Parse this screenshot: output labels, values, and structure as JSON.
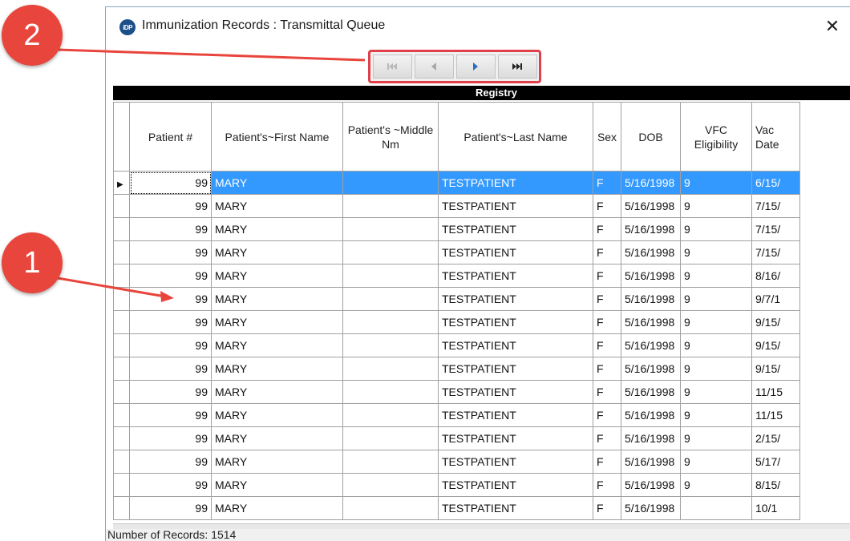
{
  "window": {
    "icon_text": "iDP",
    "title": "Immunization Records : Transmittal Queue",
    "close_symbol": "✕"
  },
  "navigator": {
    "buttons": [
      {
        "name": "first-record",
        "icon": "skip-first-icon",
        "enabled": false
      },
      {
        "name": "previous-record",
        "icon": "previous-icon",
        "enabled": false
      },
      {
        "name": "next-record",
        "icon": "next-icon",
        "enabled": true
      },
      {
        "name": "last-record",
        "icon": "skip-last-icon",
        "enabled": true
      }
    ]
  },
  "registry_label": "Registry",
  "table": {
    "columns": [
      "Patient #",
      "Patient's~First Name",
      "Patient's ~Middle Nm",
      "Patient's~Last Name",
      "Sex",
      "DOB",
      "VFC Eligibility",
      "Vac Date"
    ],
    "rows": [
      [
        "99",
        "MARY",
        "",
        "TESTPATIENT",
        "F",
        "5/16/1998",
        "9",
        "6/15/"
      ],
      [
        "99",
        "MARY",
        "",
        "TESTPATIENT",
        "F",
        "5/16/1998",
        "9",
        "7/15/"
      ],
      [
        "99",
        "MARY",
        "",
        "TESTPATIENT",
        "F",
        "5/16/1998",
        "9",
        "7/15/"
      ],
      [
        "99",
        "MARY",
        "",
        "TESTPATIENT",
        "F",
        "5/16/1998",
        "9",
        "7/15/"
      ],
      [
        "99",
        "MARY",
        "",
        "TESTPATIENT",
        "F",
        "5/16/1998",
        "9",
        "8/16/"
      ],
      [
        "99",
        "MARY",
        "",
        "TESTPATIENT",
        "F",
        "5/16/1998",
        "9",
        "9/7/1"
      ],
      [
        "99",
        "MARY",
        "",
        "TESTPATIENT",
        "F",
        "5/16/1998",
        "9",
        "9/15/"
      ],
      [
        "99",
        "MARY",
        "",
        "TESTPATIENT",
        "F",
        "5/16/1998",
        "9",
        "9/15/"
      ],
      [
        "99",
        "MARY",
        "",
        "TESTPATIENT",
        "F",
        "5/16/1998",
        "9",
        "9/15/"
      ],
      [
        "99",
        "MARY",
        "",
        "TESTPATIENT",
        "F",
        "5/16/1998",
        "9",
        "11/15"
      ],
      [
        "99",
        "MARY",
        "",
        "TESTPATIENT",
        "F",
        "5/16/1998",
        "9",
        "11/15"
      ],
      [
        "99",
        "MARY",
        "",
        "TESTPATIENT",
        "F",
        "5/16/1998",
        "9",
        "2/15/"
      ],
      [
        "99",
        "MARY",
        "",
        "TESTPATIENT",
        "F",
        "5/16/1998",
        "9",
        "5/17/"
      ],
      [
        "99",
        "MARY",
        "",
        "TESTPATIENT",
        "F",
        "5/16/1998",
        "9",
        "8/15/"
      ],
      [
        "99",
        "MARY",
        "",
        "TESTPATIENT",
        "F",
        "5/16/1998",
        "",
        "10/1"
      ]
    ],
    "selected_row": 0
  },
  "status": {
    "records_text": "Number of Records:  1514"
  },
  "callouts": [
    {
      "label": "1",
      "color": "#e8453c"
    },
    {
      "label": "2",
      "color": "#e8453c"
    }
  ],
  "colors": {
    "selection": "#3399ff",
    "highlight_border": "#e0404a",
    "header_bar": "#000000"
  }
}
